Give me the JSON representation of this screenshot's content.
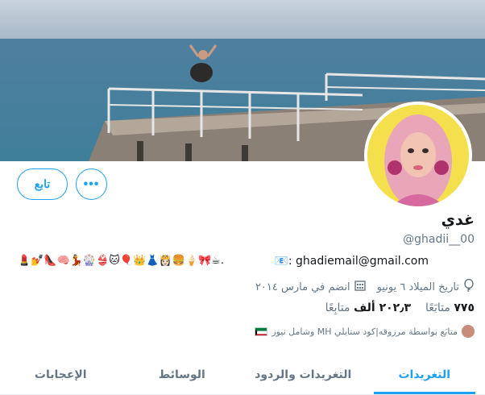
{
  "profile": {
    "name": "غدي",
    "handle": "@ghadii__00",
    "bio_text": "📧: ghadiemail@gmail.com",
    "bio_emojis": "💄💅👠🧠💃🎡👙🐱🎈👑👗👸🏻🍔🍦🎀☕.",
    "birthday": "تاريخ الميلاد ٦ يونيو",
    "joined": "انضم في مارس ٢٠١٤",
    "followed_by": "متابَع بواسطة مرزوقه|كود ستايلي MH وشامل نيوز"
  },
  "stats": {
    "following_count": "٧٧٥",
    "following_label": "متابَعًا",
    "followers_count": "٢٠٢٫٣ ألف",
    "followers_label": "متابِعًا"
  },
  "buttons": {
    "follow_label": "تابع",
    "more_label": "•••"
  },
  "tabs": [
    {
      "label": "التغريدات",
      "active": true
    },
    {
      "label": "التغريدات والردود",
      "active": false
    },
    {
      "label": "الوسائط",
      "active": false
    },
    {
      "label": "الإعجابات",
      "active": false
    }
  ],
  "icons": {
    "birthday": "balloon-icon",
    "joined": "calendar-icon"
  },
  "colors": {
    "accent": "#1da1f2",
    "secondary_text": "#657786"
  }
}
